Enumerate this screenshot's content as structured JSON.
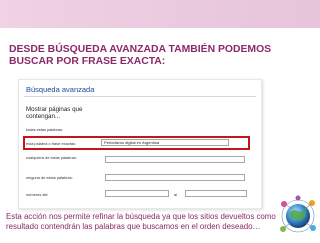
{
  "slide": {
    "title": "DESDE BÚSQUEDA AVANZADA TAMBIÉN PODEMOS BUSCAR POR FRASE EXACTA:",
    "caption": "Esta acción nos permite refinar la búsqueda ya que los sitios devueltos como resultado contendrán las palabras que buscamos en el orden deseado…"
  },
  "panel": {
    "title": "Búsqueda avanzada",
    "subhead": "Mostrar páginas que contengan...",
    "fields": [
      {
        "label": "todas estas palabras:",
        "value": ""
      },
      {
        "label": "esta palabra o frase exactas:",
        "value": "Periodismo digital en Argentina"
      },
      {
        "label": "cualquiera de estas palabras:",
        "value": ""
      },
      {
        "label": "ninguna de estas palabras:",
        "value": ""
      },
      {
        "label": "números del:",
        "value": ""
      }
    ],
    "range_separator": "al"
  },
  "colors": {
    "accent": "#8a2a68",
    "highlight": "#c0161d",
    "header_band": "#e8c8dc"
  }
}
